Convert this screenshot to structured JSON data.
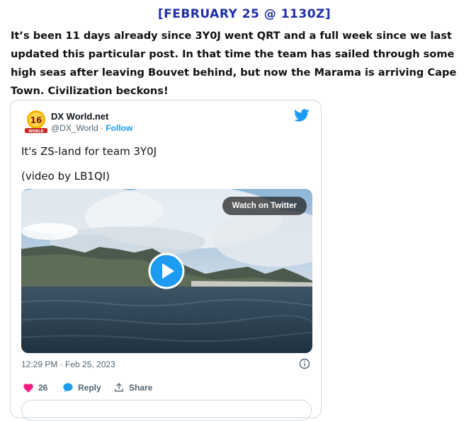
{
  "post": {
    "heading": "[FEBRUARY 25 @ 1130Z]",
    "body": "It’s been 11 days already since 3Y0J went QRT and a full week since we last updated this particular post. In that time the team has sailed through some high seas after leaving Bouvet behind, but now the Marama is arriving Cape Town. Civilization beckons!"
  },
  "tweet": {
    "author_name": "DX World.net",
    "handle": "@DX_World",
    "separator": " · ",
    "follow_label": "Follow",
    "text_line1": "It's ZS-land for team 3Y0J",
    "text_line2": "(video by LB1QI)",
    "watch_label": "Watch on Twitter",
    "timestamp": "12:29 PM · Feb 25, 2023",
    "likes": "26",
    "reply_label": "Reply",
    "share_label": "Share",
    "avatar_badge": "16",
    "avatar_logo": "WORLD",
    "colors": {
      "accent": "#1d9bf0",
      "like": "#f91880",
      "heading": "#1f2fa6"
    }
  }
}
